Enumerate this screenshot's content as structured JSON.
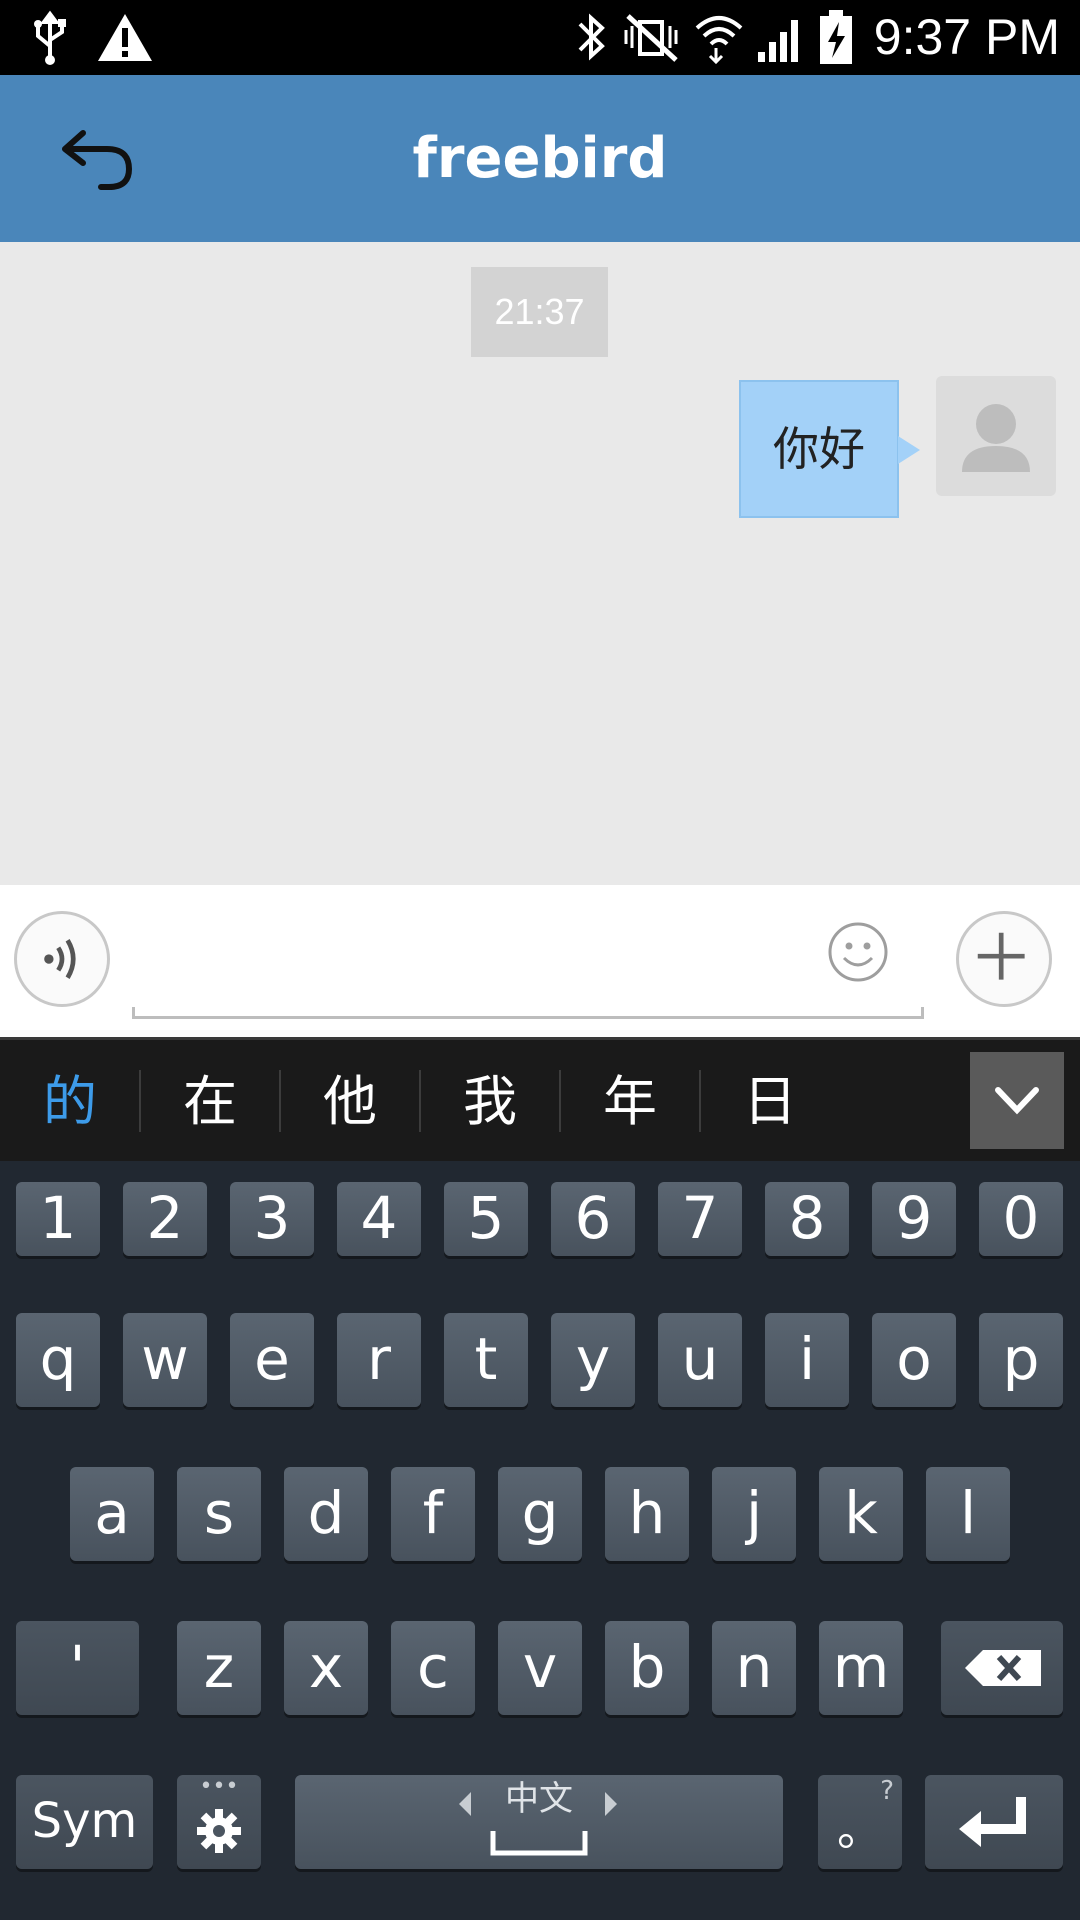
{
  "status_bar": {
    "time": "9:37 PM",
    "icons": [
      "usb-icon",
      "warning-icon",
      "bluetooth-icon",
      "mute-vibrate-icon",
      "wifi-icon",
      "signal-icon",
      "battery-charging-icon"
    ]
  },
  "header": {
    "title": "freebird",
    "back_icon": "back-arrow-icon"
  },
  "chat": {
    "timestamp": "21:37",
    "messages": [
      {
        "text": "你好",
        "sender": "self"
      }
    ]
  },
  "input_bar": {
    "value": "",
    "placeholder": ""
  },
  "keyboard": {
    "candidates": [
      "的",
      "在",
      "他",
      "我",
      "年",
      "日"
    ],
    "number_row": [
      "1",
      "2",
      "3",
      "4",
      "5",
      "6",
      "7",
      "8",
      "9",
      "0"
    ],
    "row1": [
      "q",
      "w",
      "e",
      "r",
      "t",
      "y",
      "u",
      "i",
      "o",
      "p"
    ],
    "row2": [
      "a",
      "s",
      "d",
      "f",
      "g",
      "h",
      "j",
      "k",
      "l"
    ],
    "row3": [
      "z",
      "x",
      "c",
      "v",
      "b",
      "n",
      "m"
    ],
    "apostrophe": "'",
    "sym_label": "Sym",
    "space_label": "中文",
    "period_label": "。",
    "period_hint": "?",
    "colors": {
      "accent_candidate": "#3d9be9",
      "key_bg": "#505b66",
      "keyboard_bg": "#212831"
    }
  },
  "colors": {
    "header_bg": "#4a86ba",
    "chat_bg": "#e9e9e9",
    "bubble_bg": "#a3d1f8"
  }
}
